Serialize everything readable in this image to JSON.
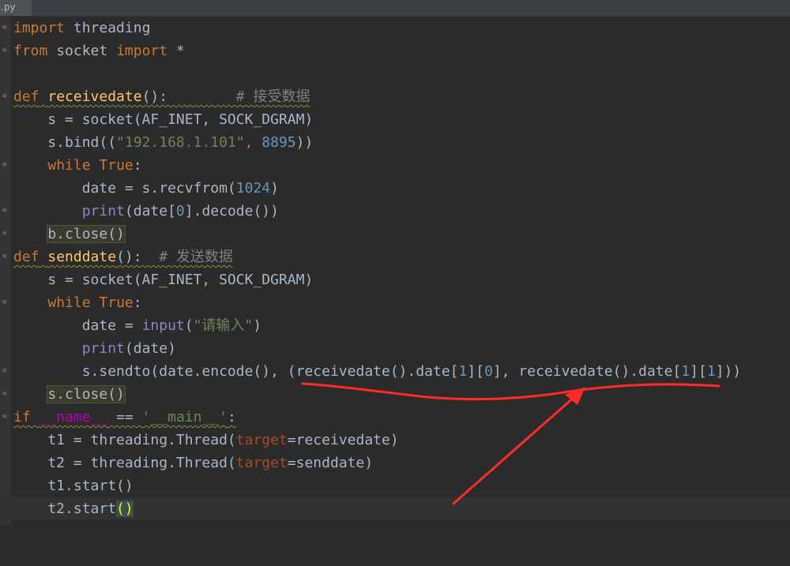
{
  "tab": {
    "filename": ".py"
  },
  "colors": {
    "annotation": "#ff2a2a",
    "background": "#2b2b2b"
  },
  "code": {
    "l1": {
      "a": "import",
      "b": " threading"
    },
    "l2": {
      "a": "from",
      "b": " socket ",
      "c": "import",
      "d": " *"
    },
    "l4": {
      "a": "def",
      "b": " ",
      "c": "receivedate",
      "d": "():        ",
      "e": "# 接受数据"
    },
    "l5": {
      "a": "    s = socket(AF_INET, SOCK_DGRAM)"
    },
    "l6": {
      "a": "    s.bind((",
      "b": "\"192.168.1.101\"",
      "c": ", ",
      "d": "8895",
      "e": "))"
    },
    "l7": {
      "a": "    ",
      "b": "while",
      "c": " ",
      "d": "True",
      "e": ":"
    },
    "l8": {
      "a": "        date = s.recvfrom(",
      "b": "1024",
      "c": ")"
    },
    "l9": {
      "a": "        ",
      "b": "print",
      "c": "(date[",
      "d": "0",
      "e": "].decode())"
    },
    "l10": {
      "a": "    ",
      "b": "b.close()"
    },
    "l11": {
      "a": "def",
      "b": " ",
      "c": "senddate",
      "d": "():  ",
      "e": "# 发送数据"
    },
    "l12": {
      "a": "    s = socket(AF_INET, SOCK_DGRAM)"
    },
    "l13": {
      "a": "    ",
      "b": "while",
      "c": " ",
      "d": "True",
      "e": ":"
    },
    "l14": {
      "a": "        date = ",
      "b": "input",
      "c": "(",
      "d": "\"请输入\"",
      "e": ")"
    },
    "l15": {
      "a": "        ",
      "b": "print",
      "c": "(date)"
    },
    "l16": {
      "a": "        s.sendto(date.encode(), (receivedate().date[",
      "b": "1",
      "c": "][",
      "d": "0",
      "e": "], receivedate().date[",
      "f": "1",
      "g": "][",
      "h": "1",
      "i": "]))"
    },
    "l17": {
      "a": "    ",
      "b": "s.close()"
    },
    "l18": {
      "a": "if",
      "b": " ",
      "c": "__name__",
      "d": " == ",
      "e": "'__main__'",
      "f": ":"
    },
    "l19": {
      "a": "    t1 = threading.Thread(",
      "b": "target",
      "c": "=receivedate)"
    },
    "l20": {
      "a": "    t2 = threading.Thread(",
      "b": "target",
      "c": "=senddate)"
    },
    "l21": {
      "a": "    t1.start()"
    },
    "l22": {
      "a": "    t2.start",
      "b": "()"
    }
  }
}
